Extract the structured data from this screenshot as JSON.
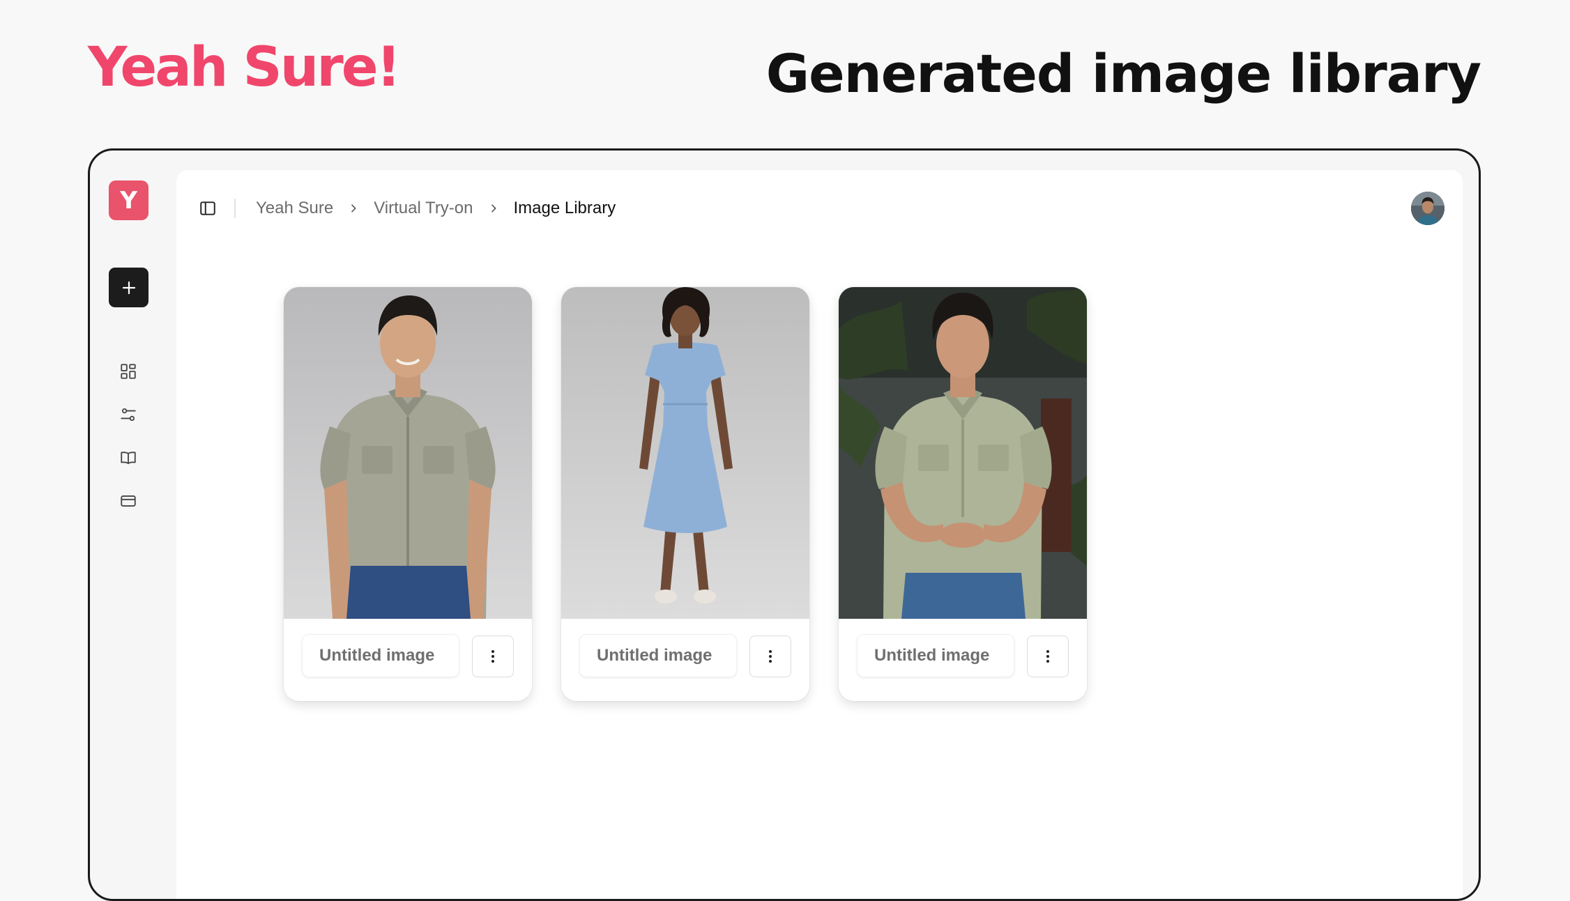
{
  "page": {
    "brand": "Yeah Sure!",
    "heading": "Generated image library"
  },
  "app": {
    "logo_letter": "Y",
    "rail": [
      {
        "name": "new-button",
        "icon": "plus-icon"
      },
      {
        "name": "dashboard",
        "icon": "grid-icon"
      },
      {
        "name": "settings",
        "icon": "sliders-icon"
      },
      {
        "name": "library",
        "icon": "book-icon"
      },
      {
        "name": "billing",
        "icon": "credit-card-icon"
      }
    ],
    "breadcrumb": {
      "items": [
        "Yeah Sure",
        "Virtual Try-on",
        "Image Library"
      ]
    }
  },
  "library": {
    "cards": [
      {
        "title": "Untitled image",
        "subject": "man in sage short-sleeve shirt and jeans"
      },
      {
        "title": "Untitled image",
        "subject": "woman in light blue dress"
      },
      {
        "title": "Untitled image",
        "subject": "man in pale green shirt and jeans, dark backdrop"
      }
    ]
  },
  "colors": {
    "brand": "#f0466c",
    "logo_bg": "#e9536b",
    "new_button_bg": "#1c1c1c"
  }
}
